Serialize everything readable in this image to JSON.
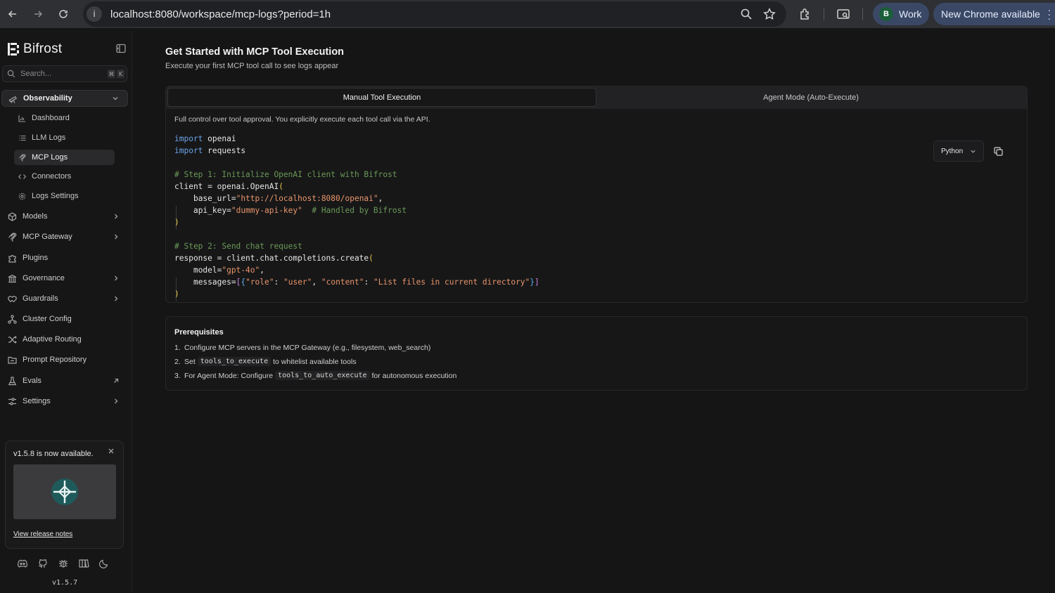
{
  "browser": {
    "url": "localhost:8080/workspace/mcp-logs?period=1h",
    "profile_initial": "B",
    "profile_label": "Work",
    "update_label": "New Chrome available"
  },
  "sidebar": {
    "brand": "Bifrost",
    "search_placeholder": "Search...",
    "search_shortcut": [
      "⌘",
      "K"
    ],
    "section": "Observability",
    "sub_items": [
      {
        "label": "Dashboard",
        "icon": "chart-icon"
      },
      {
        "label": "LLM Logs",
        "icon": "list-icon"
      },
      {
        "label": "MCP Logs",
        "icon": "mcp-icon",
        "active": true
      },
      {
        "label": "Connectors",
        "icon": "code-icon"
      },
      {
        "label": "Logs Settings",
        "icon": "gear-icon"
      }
    ],
    "items": [
      {
        "label": "Models",
        "icon": "cube-icon",
        "chevron": "right"
      },
      {
        "label": "MCP Gateway",
        "icon": "mcp-icon",
        "chevron": "right"
      },
      {
        "label": "Plugins",
        "icon": "puzzle-icon"
      },
      {
        "label": "Governance",
        "icon": "bank-icon",
        "chevron": "right"
      },
      {
        "label": "Guardrails",
        "icon": "handshake-icon",
        "chevron": "right"
      },
      {
        "label": "Cluster Config",
        "icon": "network-icon"
      },
      {
        "label": "Adaptive Routing",
        "icon": "shuffle-icon"
      },
      {
        "label": "Prompt Repository",
        "icon": "folder-icon"
      },
      {
        "label": "Evals",
        "icon": "flask-icon",
        "chevron": "external"
      },
      {
        "label": "Settings",
        "icon": "sliders-icon",
        "chevron": "right"
      }
    ],
    "release": {
      "title": "v1.5.8 is now available.",
      "link": "View release notes"
    },
    "version": "v1.5.7"
  },
  "main": {
    "title": "Get Started with MCP Tool Execution",
    "subtitle": "Execute your first MCP tool call to see logs appear",
    "tabs": [
      "Manual Tool Execution",
      "Agent Mode (Auto-Execute)"
    ],
    "active_tab": 0,
    "description": "Full control over tool approval. You explicitly execute each tool call via the API.",
    "language": "Python",
    "code": {
      "line1": "openai",
      "line2": "requests",
      "comment1": "# Step 1: Initialize OpenAI client with Bifrost",
      "client_assign": "client = openai.OpenAI",
      "base_url_key": "base_url=",
      "base_url_val": "\"http://localhost:8080/openai\"",
      "api_key_key": "api_key=",
      "api_key_val": "\"dummy-api-key\"",
      "api_key_comment": "# Handled by Bifrost",
      "comment2": "# Step 2: Send chat request",
      "response_assign": "response = client.chat.completions.create",
      "model_key": "model=",
      "model_val": "\"gpt-4o\"",
      "messages_key": "messages=",
      "role_key": "\"role\"",
      "role_val": "\"user\"",
      "content_key": "\"content\"",
      "content_val": "\"List files in current directory\""
    },
    "prereq": {
      "title": "Prerequisites",
      "items": [
        {
          "num": "1.",
          "before": "Configure MCP servers in the MCP Gateway (e.g., filesystem, web_search)"
        },
        {
          "num": "2.",
          "before": "Set",
          "code": "tools_to_execute",
          "after": "to whitelist available tools"
        },
        {
          "num": "3.",
          "before": "For Agent Mode: Configure",
          "code": "tools_to_auto_execute",
          "after": "for autonomous execution"
        }
      ]
    }
  },
  "colors": {
    "background": "#151516",
    "keyword": "#6aa4e8",
    "comment": "#6a9955",
    "string": "#e8956a",
    "chrome_pill": "#3a4866"
  }
}
